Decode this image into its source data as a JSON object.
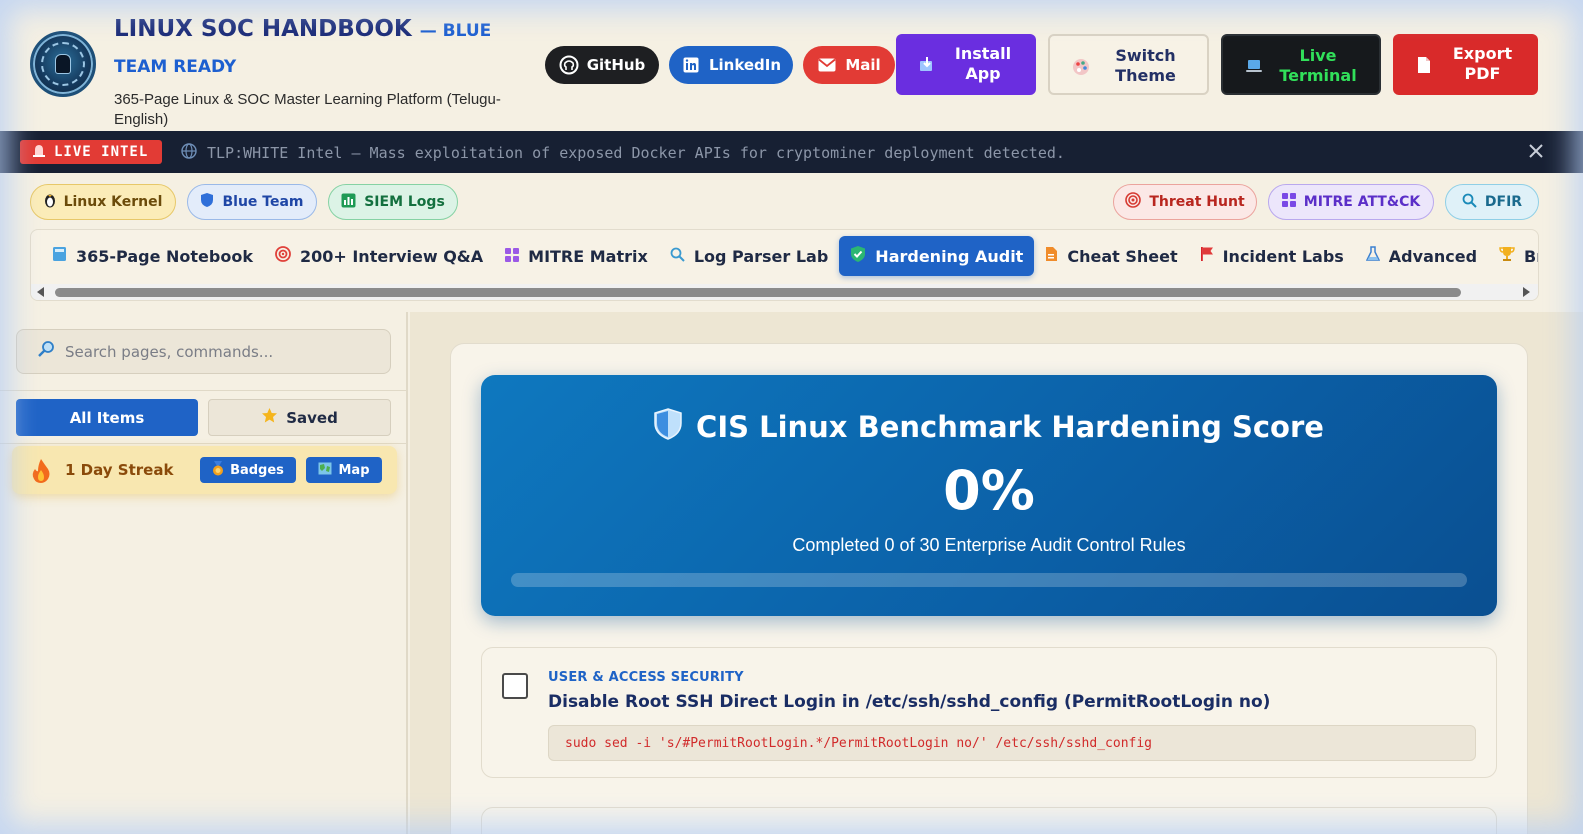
{
  "header": {
    "title_main": "LINUX SOC HANDBOOK",
    "title_accent": "— BLUE TEAM READY",
    "subtitle": "365-Page Linux & SOC Master Learning Platform (Telugu-English)",
    "buttons": {
      "github": "GitHub",
      "linkedin": "LinkedIn",
      "mail": "Mail",
      "install": "Install App",
      "theme": "Switch Theme",
      "terminal": "Live Terminal",
      "export": "Export PDF"
    },
    "colors": {
      "title": "#1c2c78",
      "accent": "#1d5fd0",
      "install": "#6a2ee0",
      "terminal_text": "#31e05a",
      "export": "#d92a2a"
    }
  },
  "intel": {
    "badge": "LIVE INTEL",
    "text": "TLP:WHITE Intel — Mass exploitation of exposed Docker APIs for cryptominer deployment detected."
  },
  "tags": {
    "left": [
      "Linux Kernel",
      "Blue Team",
      "SIEM Logs"
    ],
    "right": [
      "Threat Hunt",
      "MITRE ATT&CK",
      "DFIR"
    ]
  },
  "nav": {
    "tabs": [
      {
        "label": "365-Page Notebook",
        "icon": "notebook-icon"
      },
      {
        "label": "200+ Interview Q&A",
        "icon": "target-icon"
      },
      {
        "label": "MITRE Matrix",
        "icon": "grid-icon"
      },
      {
        "label": "Log Parser Lab",
        "icon": "search-icon"
      },
      {
        "label": "Hardening Audit",
        "icon": "shield-check-icon"
      },
      {
        "label": "Cheat Sheet",
        "icon": "document-icon"
      },
      {
        "label": "Incident Labs",
        "icon": "flag-icon"
      },
      {
        "label": "Advanced",
        "icon": "flask-icon"
      },
      {
        "label": "Brand C",
        "icon": "trophy-icon"
      }
    ],
    "active": "Hardening Audit"
  },
  "sidebar": {
    "search_placeholder": "Search pages, commands...",
    "all_items": "All Items",
    "saved": "Saved",
    "streak": "1 Day Streak",
    "badges": "Badges",
    "map": "Map"
  },
  "audit": {
    "title": "CIS Linux Benchmark Hardening Score",
    "score": "0%",
    "score_fraction": 0,
    "description": "Completed 0 of 30 Enterprise Audit Control Rules",
    "rules": [
      {
        "category": "USER & ACCESS SECURITY",
        "title": "Disable Root SSH Direct Login in /etc/ssh/sshd_config (PermitRootLogin no)",
        "command": "sudo sed -i 's/#PermitRootLogin.*/PermitRootLogin no/' /etc/ssh/sshd_config",
        "checked": false
      }
    ]
  }
}
